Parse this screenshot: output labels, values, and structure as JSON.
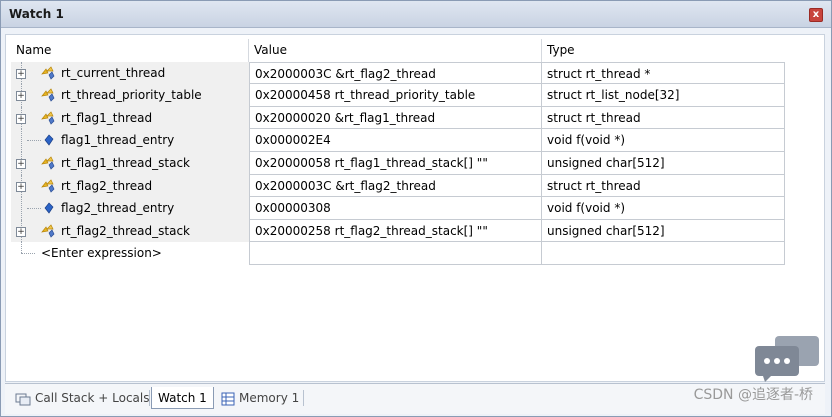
{
  "window": {
    "title": "Watch 1",
    "close_label": "x"
  },
  "columns": {
    "name": "Name",
    "value": "Value",
    "type": "Type"
  },
  "rows": [
    {
      "name": "rt_current_thread",
      "value": "0x2000003C &rt_flag2_thread",
      "type": "struct rt_thread *",
      "icon": "struct-icon",
      "expandable": true
    },
    {
      "name": "rt_thread_priority_table",
      "value": "0x20000458 rt_thread_priority_table",
      "type": "struct rt_list_node[32]",
      "icon": "struct-icon",
      "expandable": true
    },
    {
      "name": "rt_flag1_thread",
      "value": "0x20000020 &rt_flag1_thread",
      "type": "struct rt_thread",
      "icon": "struct-icon",
      "expandable": true
    },
    {
      "name": "flag1_thread_entry",
      "value": "0x000002E4",
      "type": "void f(void *)",
      "icon": "function-icon",
      "expandable": false
    },
    {
      "name": "rt_flag1_thread_stack",
      "value": "0x20000058 rt_flag1_thread_stack[] \"\"",
      "type": "unsigned char[512]",
      "icon": "struct-icon",
      "expandable": true
    },
    {
      "name": "rt_flag2_thread",
      "value": "0x2000003C &rt_flag2_thread",
      "type": "struct rt_thread",
      "icon": "struct-icon",
      "expandable": true
    },
    {
      "name": "flag2_thread_entry",
      "value": "0x00000308",
      "type": "void f(void *)",
      "icon": "function-icon",
      "expandable": false
    },
    {
      "name": "rt_flag2_thread_stack",
      "value": "0x20000258 rt_flag2_thread_stack[] \"\"",
      "type": "unsigned char[512]",
      "icon": "struct-icon",
      "expandable": true
    }
  ],
  "enter_expression": "<Enter expression>",
  "tabs": [
    {
      "label": "Call Stack + Locals",
      "icon": "call-stack-icon",
      "active": false
    },
    {
      "label": "Watch 1",
      "icon": "",
      "active": true
    },
    {
      "label": "Memory 1",
      "icon": "memory-icon",
      "active": false
    }
  ],
  "watermark": "CSDN @追逐者-桥",
  "colors": {
    "title_bg": "#c9d3e3",
    "close": "#c8443d",
    "struct_icon": "#e6b422",
    "function_icon": "#2b63c6"
  }
}
